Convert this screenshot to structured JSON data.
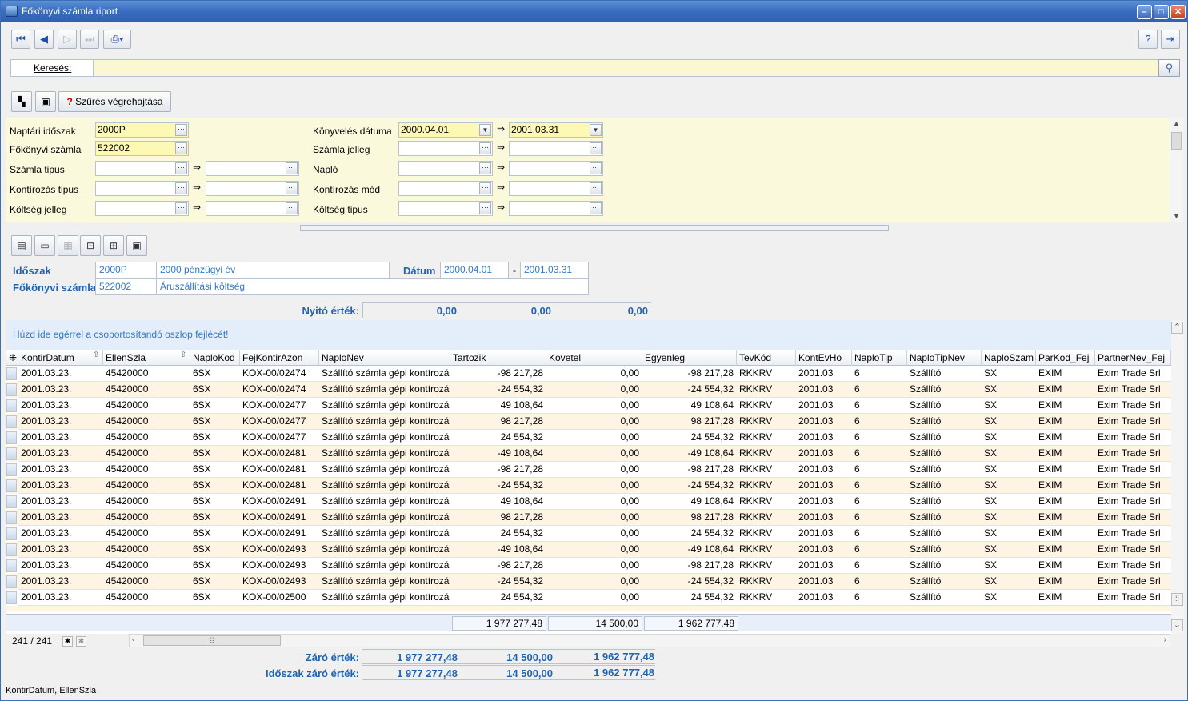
{
  "window": {
    "title": "Főkönyvi számla riport"
  },
  "search": {
    "label": "Keresés:",
    "value": ""
  },
  "filter_toolbar": {
    "execute_label": "Szűrés végrehajtása"
  },
  "filters": {
    "naptari_idoszak": {
      "label": "Naptári időszak",
      "value": "2000P"
    },
    "fokonyvi_szamla": {
      "label": "Főkönyvi számla",
      "value": "522002"
    },
    "szamla_tipus": {
      "label": "Számla tipus"
    },
    "kontirozas_tipus": {
      "label": "Kontírozás tipus"
    },
    "koltseg_jelleg": {
      "label": "Költség jelleg"
    },
    "konyveles_datuma": {
      "label": "Könyvelés dátuma",
      "from": "2000.04.01",
      "to": "2001.03.31"
    },
    "szamla_jelleg": {
      "label": "Számla jelleg"
    },
    "naplo": {
      "label": "Napló"
    },
    "kontirozas_mod": {
      "label": "Kontírozás mód"
    },
    "koltseg_tipus": {
      "label": "Költség tipus"
    }
  },
  "header": {
    "idoszak_label": "Időszak",
    "idoszak_code": "2000P",
    "idoszak_name": "2000 pénzügyi év",
    "datum_label": "Dátum",
    "datum_from": "2000.04.01",
    "datum_sep": "-",
    "datum_to": "2001.03.31",
    "szamla_label": "Főkönyvi számla",
    "szamla_code": "522002",
    "szamla_name": "Áruszállítási költség",
    "nyito_label": "Nyitó érték:",
    "nyito_tartozik": "0,00",
    "nyito_kovetel": "0,00",
    "nyito_egyenleg": "0,00"
  },
  "grid": {
    "group_hint": "Húzd ide egérrel a csoportosítandó oszlop fejlécét!",
    "columns": [
      "KontirDatum",
      "EllenSzla",
      "NaploKod",
      "FejKontirAzon",
      "NaploNev",
      "Tartozik",
      "Kovetel",
      "Egyenleg",
      "TevKód",
      "KontEvHo",
      "NaploTip",
      "NaploTipNev",
      "NaploSzam",
      "ParKod_Fej",
      "PartnerNev_Fej"
    ],
    "rows": [
      [
        "2001.03.23.",
        "45420000",
        "6SX",
        "KOX-00/02474",
        "Szállító számla gépi kontírozás",
        "-98 217,28",
        "0,00",
        "-98 217,28",
        "RKKRV",
        "2001.03",
        "6",
        "Szállító",
        "SX",
        "EXIM",
        "Exim Trade Srl"
      ],
      [
        "2001.03.23.",
        "45420000",
        "6SX",
        "KOX-00/02474",
        "Szállító számla gépi kontírozás",
        "-24 554,32",
        "0,00",
        "-24 554,32",
        "RKKRV",
        "2001.03",
        "6",
        "Szállító",
        "SX",
        "EXIM",
        "Exim Trade Srl"
      ],
      [
        "2001.03.23.",
        "45420000",
        "6SX",
        "KOX-00/02477",
        "Szállító számla gépi kontírozás",
        "49 108,64",
        "0,00",
        "49 108,64",
        "RKKRV",
        "2001.03",
        "6",
        "Szállító",
        "SX",
        "EXIM",
        "Exim Trade Srl"
      ],
      [
        "2001.03.23.",
        "45420000",
        "6SX",
        "KOX-00/02477",
        "Szállító számla gépi kontírozás",
        "98 217,28",
        "0,00",
        "98 217,28",
        "RKKRV",
        "2001.03",
        "6",
        "Szállító",
        "SX",
        "EXIM",
        "Exim Trade Srl"
      ],
      [
        "2001.03.23.",
        "45420000",
        "6SX",
        "KOX-00/02477",
        "Szállító számla gépi kontírozás",
        "24 554,32",
        "0,00",
        "24 554,32",
        "RKKRV",
        "2001.03",
        "6",
        "Szállító",
        "SX",
        "EXIM",
        "Exim Trade Srl"
      ],
      [
        "2001.03.23.",
        "45420000",
        "6SX",
        "KOX-00/02481",
        "Szállító számla gépi kontírozás",
        "-49 108,64",
        "0,00",
        "-49 108,64",
        "RKKRV",
        "2001.03",
        "6",
        "Szállító",
        "SX",
        "EXIM",
        "Exim Trade Srl"
      ],
      [
        "2001.03.23.",
        "45420000",
        "6SX",
        "KOX-00/02481",
        "Szállító számla gépi kontírozás",
        "-98 217,28",
        "0,00",
        "-98 217,28",
        "RKKRV",
        "2001.03",
        "6",
        "Szállító",
        "SX",
        "EXIM",
        "Exim Trade Srl"
      ],
      [
        "2001.03.23.",
        "45420000",
        "6SX",
        "KOX-00/02481",
        "Szállító számla gépi kontírozás",
        "-24 554,32",
        "0,00",
        "-24 554,32",
        "RKKRV",
        "2001.03",
        "6",
        "Szállító",
        "SX",
        "EXIM",
        "Exim Trade Srl"
      ],
      [
        "2001.03.23.",
        "45420000",
        "6SX",
        "KOX-00/02491",
        "Szállító számla gépi kontírozás",
        "49 108,64",
        "0,00",
        "49 108,64",
        "RKKRV",
        "2001.03",
        "6",
        "Szállító",
        "SX",
        "EXIM",
        "Exim Trade Srl"
      ],
      [
        "2001.03.23.",
        "45420000",
        "6SX",
        "KOX-00/02491",
        "Szállító számla gépi kontírozás",
        "98 217,28",
        "0,00",
        "98 217,28",
        "RKKRV",
        "2001.03",
        "6",
        "Szállító",
        "SX",
        "EXIM",
        "Exim Trade Srl"
      ],
      [
        "2001.03.23.",
        "45420000",
        "6SX",
        "KOX-00/02491",
        "Szállító számla gépi kontírozás",
        "24 554,32",
        "0,00",
        "24 554,32",
        "RKKRV",
        "2001.03",
        "6",
        "Szállító",
        "SX",
        "EXIM",
        "Exim Trade Srl"
      ],
      [
        "2001.03.23.",
        "45420000",
        "6SX",
        "KOX-00/02493",
        "Szállító számla gépi kontírozás",
        "-49 108,64",
        "0,00",
        "-49 108,64",
        "RKKRV",
        "2001.03",
        "6",
        "Szállító",
        "SX",
        "EXIM",
        "Exim Trade Srl"
      ],
      [
        "2001.03.23.",
        "45420000",
        "6SX",
        "KOX-00/02493",
        "Szállító számla gépi kontírozás",
        "-98 217,28",
        "0,00",
        "-98 217,28",
        "RKKRV",
        "2001.03",
        "6",
        "Szállító",
        "SX",
        "EXIM",
        "Exim Trade Srl"
      ],
      [
        "2001.03.23.",
        "45420000",
        "6SX",
        "KOX-00/02493",
        "Szállító számla gépi kontírozás",
        "-24 554,32",
        "0,00",
        "-24 554,32",
        "RKKRV",
        "2001.03",
        "6",
        "Szállító",
        "SX",
        "EXIM",
        "Exim Trade Srl"
      ],
      [
        "2001.03.23.",
        "45420000",
        "6SX",
        "KOX-00/02500",
        "Szállító számla gépi kontírozás",
        "24 554,32",
        "0,00",
        "24 554,32",
        "RKKRV",
        "2001.03",
        "6",
        "Szállító",
        "SX",
        "EXIM",
        "Exim Trade Srl"
      ]
    ],
    "totals": {
      "tartozik": "1 977 277,48",
      "kovetel": "14 500,00",
      "egyenleg": "1 962 777,48"
    },
    "record_count": "241 / 241"
  },
  "closing": {
    "zaro_label": "Záró érték:",
    "zaro_tartozik": "1 977 277,48",
    "zaro_kovetel": "14 500,00",
    "zaro_egyenleg": "1 962 777,48",
    "idoszak_zaro_label": "Időszak záró érték:",
    "idoszak_zaro_tartozik": "1 977 277,48",
    "idoszak_zaro_kovetel": "14 500,00",
    "idoszak_zaro_egyenleg": "1 962 777,48"
  },
  "status": {
    "text": "KontirDatum, EllenSzla"
  }
}
